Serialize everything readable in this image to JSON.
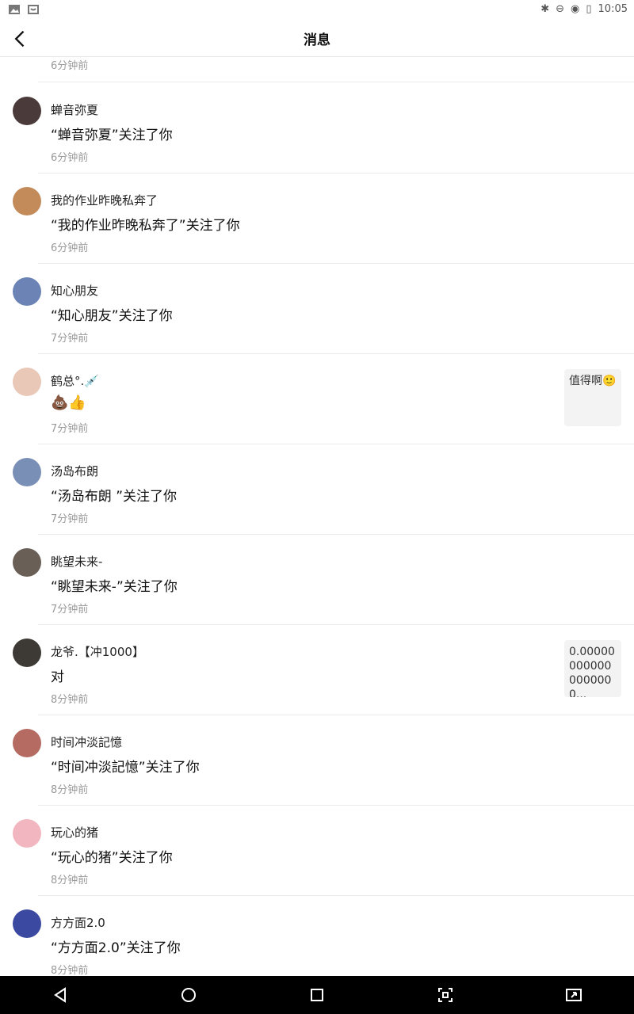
{
  "status_bar": {
    "time": "10:05",
    "left_icons": [
      "image-icon",
      "store-icon"
    ],
    "right_icons": [
      "bluetooth-icon",
      "do-not-disturb-icon",
      "wifi-icon",
      "battery-icon"
    ]
  },
  "header": {
    "title": "消息",
    "back_icon": "chevron-left-icon"
  },
  "list": {
    "partial_time": "6分钟前",
    "items": [
      {
        "name": "蝉音弥夏",
        "message": "“蝉音弥夏”关注了你",
        "time": "6分钟前",
        "avatar_color": "#4b3a3a"
      },
      {
        "name": "我的作业昨晚私奔了",
        "message": "“我的作业昨晚私奔了”关注了你",
        "time": "6分钟前",
        "avatar_color": "#c38a5a"
      },
      {
        "name": "知心朋友",
        "message": "“知心朋友”关注了你",
        "time": "7分钟前",
        "avatar_color": "#6c84b5"
      },
      {
        "name": "鹤总°.💉",
        "message": "💩👍",
        "time": "7分钟前",
        "avatar_color": "#e9c8b8",
        "thumb": {
          "text": "值得啊🙂"
        }
      },
      {
        "name": "汤岛布朗",
        "message": "“汤岛布朗 ”关注了你",
        "time": "7分钟前",
        "avatar_color": "#7a8fb5"
      },
      {
        "name": "眺望未来-",
        "message": "“眺望未来-”关注了你",
        "time": "7分钟前",
        "avatar_color": "#6a5f56"
      },
      {
        "name": "龙爷.【冲1000】",
        "message": "对",
        "time": "8分钟前",
        "avatar_color": "#3d3a35",
        "thumb": {
          "text": "0.000000000000000000..."
        }
      },
      {
        "name": "时间冲淡記憶",
        "message": "“时间冲淡記憶”关注了你",
        "time": "8分钟前",
        "avatar_color": "#b56a62"
      },
      {
        "name": "玩心的猪",
        "message": "“玩心的猪”关注了你",
        "time": "8分钟前",
        "avatar_color": "#f1b6c0"
      },
      {
        "name": "方方面2.0",
        "message": "“方方面2.0”关注了你",
        "time": "8分钟前",
        "avatar_color": "#3b4aa0"
      }
    ]
  },
  "nav_bar": {
    "buttons": [
      "back-triangle-icon",
      "home-circle-icon",
      "recents-square-icon",
      "screenshot-icon",
      "pip-icon"
    ]
  }
}
